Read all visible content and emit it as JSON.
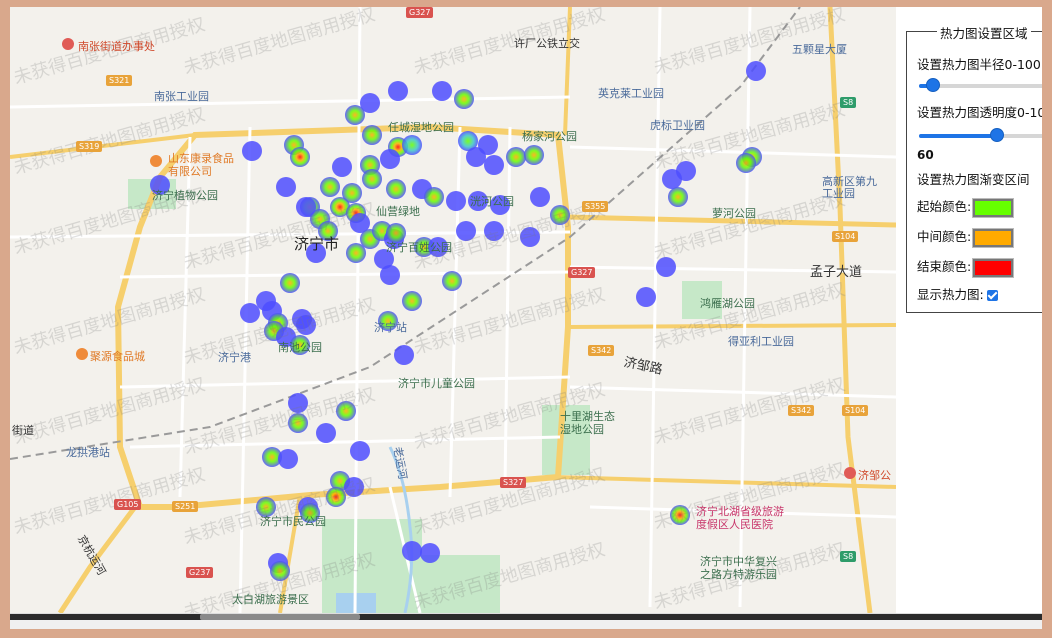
{
  "panel": {
    "legend": "热力图设置区域",
    "radius_label": "设置热力图半径0-100",
    "radius_value_fraction": 0.11,
    "opacity_label": "设置热力图透明度0-100",
    "opacity_value": "60",
    "opacity_value_fraction": 0.6,
    "gradient_label": "设置热力图渐变区间",
    "start_color_label": "起始颜色:",
    "mid_color_label": "中间颜色:",
    "end_color_label": "结束颜色:",
    "show_label": "显示热力图:",
    "show_checked": true
  },
  "colors": {
    "start": "#66ff00",
    "mid": "#ffaa00",
    "end": "#ff0000",
    "heat_cool": "#4d4dff"
  },
  "watermark": "未获得百度地图商用授权",
  "map_labels": {
    "nanzhang_office": "南张街道办事处",
    "nanzhang_park": "南张工业园",
    "kanggin": "山东康录食品",
    "kanggin2": "有限公司",
    "botanic": "济宁植物公园",
    "city": "济宁市",
    "rencheng_wetland": "任城湿地公园",
    "yangjiahe": "杨家河公园",
    "guanying": "仙营绿地",
    "huohe": "洸河公园",
    "jiningpark": "济宁百姓公园",
    "yingke": "英克莱工业园",
    "huhu": "虎标卫业园",
    "wuke": "五颗星大厦",
    "gaoxin": "高新区第九",
    "gaoxin2": "工业园",
    "lianhe": "萝河公园",
    "mengzi": "孟子大道",
    "honghu": "鸿雁湖公园",
    "deyali": "得亚利工业园",
    "jizou": "济邹路",
    "jiningzhan": "济宁站",
    "nanchi": "南池公园",
    "jugao": "聚源食品城",
    "jininggang": "济宁港",
    "children": "济宁市儿童公园",
    "shilihu": "十里湖生态",
    "shilihu2": "湿地公园",
    "longgong": "龙拱港站",
    "minzhu": "济宁市民公园",
    "beihu": "济宁北湖省级旅游",
    "beihu2": "度假区人民医院",
    "zhonghua": "济宁市中华复兴",
    "zhonghua2": "之路方特游乐园",
    "taibaihu": "太白湖旅游景区",
    "xuzhou": "许厂公铁立交",
    "jizoucity": "济邹公",
    "jinghang": "京杭运河",
    "laoyunhe": "老运河",
    "jiedao": "街道"
  },
  "road_shields": [
    "G327",
    "S321",
    "S319",
    "S355",
    "S342",
    "G327",
    "G105",
    "S251",
    "G237",
    "S104",
    "S342",
    "S104",
    "S8",
    "S327",
    "S8"
  ]
}
